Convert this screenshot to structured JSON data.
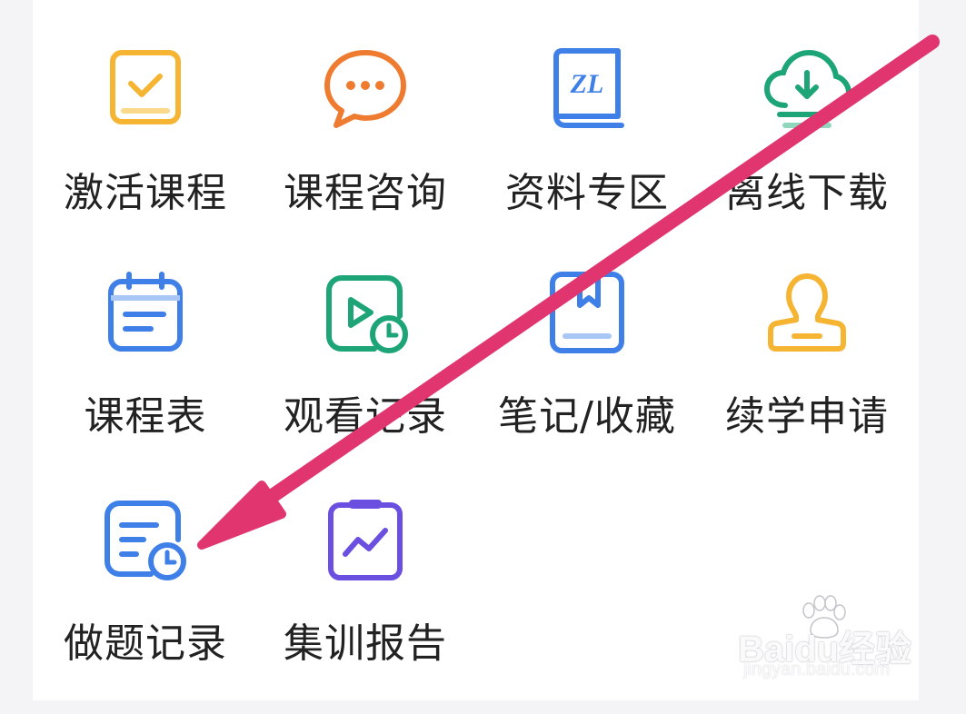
{
  "menu": {
    "items": [
      {
        "label": "激活课程",
        "icon": "checkbox-icon",
        "color": "#F5B532"
      },
      {
        "label": "课程咨询",
        "icon": "chat-bubble-icon",
        "color": "#EE7B30"
      },
      {
        "label": "资料专区",
        "icon": "book-icon",
        "color": "#3F7FE8"
      },
      {
        "label": "离线下载",
        "icon": "cloud-download-icon",
        "color": "#1DA578"
      },
      {
        "label": "课程表",
        "icon": "calendar-icon",
        "color": "#3F7FE8"
      },
      {
        "label": "观看记录",
        "icon": "video-history-icon",
        "color": "#1DA578"
      },
      {
        "label": "笔记/收藏",
        "icon": "bookmark-book-icon",
        "color": "#3F7FE8"
      },
      {
        "label": "续学申请",
        "icon": "stamp-icon",
        "color": "#F5B532"
      },
      {
        "label": "做题记录",
        "icon": "quiz-history-icon",
        "color": "#3F7FE8"
      },
      {
        "label": "集训报告",
        "icon": "report-chart-icon",
        "color": "#6A4FE0"
      }
    ]
  },
  "annotation": {
    "arrow_color": "#E0356F"
  },
  "watermark": {
    "main": "Baidu经验",
    "sub": "jingyan.baidu.com"
  }
}
